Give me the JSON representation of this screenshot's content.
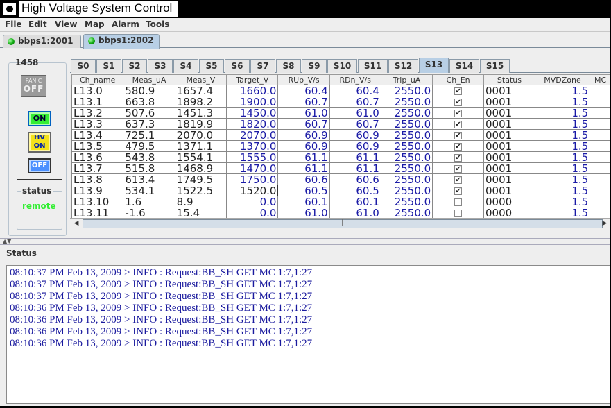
{
  "window": {
    "title": "High Voltage System Control"
  },
  "menu": [
    "File",
    "Edit",
    "View",
    "Map",
    "Alarm",
    "Tools"
  ],
  "server_tabs": [
    {
      "label": "bbps1:2001",
      "active": false,
      "status_color": "#22cc22"
    },
    {
      "label": "bbps1:2002",
      "active": true,
      "status_color": "#22cc22"
    }
  ],
  "crate": {
    "id": "1458",
    "panic_label_top": "PANIC",
    "panic_label": "OFF",
    "on_label": "ON",
    "hv_label": "HV",
    "hvon_label": "ON",
    "off_label": "OFF",
    "status_label": "status",
    "status_value": "remote"
  },
  "slot_tabs": [
    "S0",
    "S1",
    "S2",
    "S3",
    "S4",
    "S5",
    "S6",
    "S7",
    "S8",
    "S9",
    "S10",
    "S11",
    "S12",
    "S13",
    "S14",
    "S15"
  ],
  "active_slot": "S13",
  "table": {
    "columns": [
      "Ch_name",
      "Meas_uA",
      "Meas_V",
      "Target_V",
      "RUp_V/s",
      "RDn_V/s",
      "Trip_uA",
      "Ch_En",
      "Status",
      "MVDZone",
      "MC"
    ],
    "rows": [
      [
        "L13.0",
        "580.9",
        "1657.4",
        "1660.0",
        "60.4",
        "60.4",
        "2550.0",
        true,
        "0001",
        "1.5",
        ""
      ],
      [
        "L13.1",
        "663.8",
        "1898.2",
        "1900.0",
        "60.7",
        "60.7",
        "2550.0",
        true,
        "0001",
        "1.5",
        ""
      ],
      [
        "L13.2",
        "507.6",
        "1451.3",
        "1450.0",
        "61.0",
        "61.0",
        "2550.0",
        true,
        "0001",
        "1.5",
        ""
      ],
      [
        "L13.3",
        "637.3",
        "1819.9",
        "1820.0",
        "60.7",
        "60.7",
        "2550.0",
        true,
        "0001",
        "1.5",
        ""
      ],
      [
        "L13.4",
        "725.1",
        "2070.0",
        "2070.0",
        "60.9",
        "60.9",
        "2550.0",
        true,
        "0001",
        "1.5",
        ""
      ],
      [
        "L13.5",
        "479.5",
        "1371.1",
        "1370.0",
        "60.9",
        "60.9",
        "2550.0",
        true,
        "0001",
        "1.5",
        ""
      ],
      [
        "L13.6",
        "543.8",
        "1554.1",
        "1555.0",
        "61.1",
        "61.1",
        "2550.0",
        true,
        "0001",
        "1.5",
        ""
      ],
      [
        "L13.7",
        "515.8",
        "1468.9",
        "1470.0",
        "61.1",
        "61.1",
        "2550.0",
        true,
        "0001",
        "1.5",
        ""
      ],
      [
        "L13.8",
        "613.4",
        "1749.5",
        "1750.0",
        "60.6",
        "60.6",
        "2550.0",
        true,
        "0001",
        "1.5",
        ""
      ],
      [
        "L13.9",
        "534.1",
        "1522.5",
        "1520.0",
        "60.5",
        "60.5",
        "2550.0",
        true,
        "0001",
        "1.5",
        ""
      ],
      [
        "L13.10",
        "1.6",
        "8.9",
        "0.0",
        "60.1",
        "60.1",
        "2550.0",
        false,
        "0000",
        "1.5",
        ""
      ],
      [
        "L13.11",
        "-1.6",
        "15.4",
        "0.0",
        "61.0",
        "61.0",
        "2550.0",
        false,
        "0000",
        "1.5",
        ""
      ]
    ],
    "editing_cell": {
      "row": 9,
      "col": 3
    }
  },
  "log": {
    "title": "Status",
    "lines": [
      "08:10:37 PM Feb 13, 2009 > INFO : Request:BB_SH GET MC 1:7,1:27",
      "08:10:37 PM Feb 13, 2009 > INFO : Request:BB_SH GET MC 1:7,1:27",
      "08:10:37 PM Feb 13, 2009 > INFO : Request:BB_SH GET MC 1:7,1:27",
      "08:10:36 PM Feb 13, 2009 > INFO : Request:BB_SH GET MC 1:7,1:27",
      "08:10:36 PM Feb 13, 2009 > INFO : Request:BB_SH GET MC 1:7,1:27",
      "08:10:36 PM Feb 13, 2009 > INFO : Request:BB_SH GET MC 1:7,1:27",
      "08:10:36 PM Feb 13, 2009 > INFO : Request:BB_SH GET MC 1:7,1:27"
    ]
  },
  "colors": {
    "value_blue": "#1a1aa6",
    "log_blue": "#1a1a9e",
    "tab_active": "#b8cfe5",
    "status_green": "#33ee33"
  }
}
